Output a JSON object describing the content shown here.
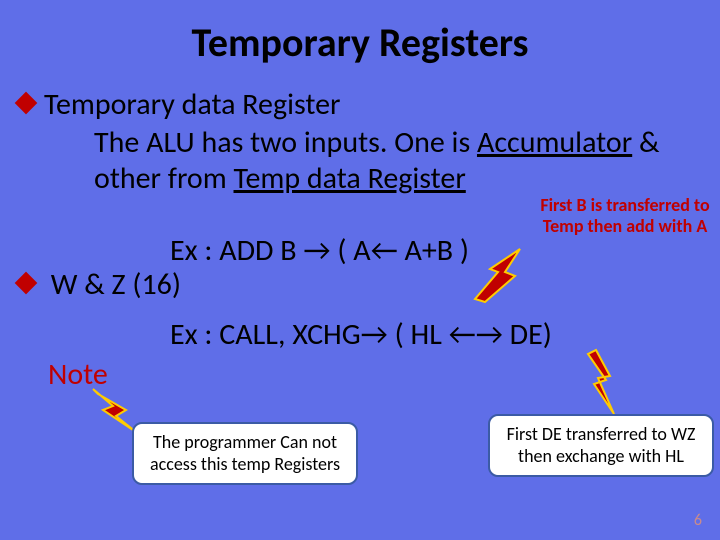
{
  "title": "Temporary Registers",
  "bullets": {
    "b1": "Temporary data Register",
    "b1_line1a": "The ALU has two inputs. One is ",
    "b1_line1b": "Accumulator",
    "b1_line1c": " &",
    "b1_line2a": "other from ",
    "b1_line2b": "Temp data Register",
    "b1_ex": "Ex : ADD B → ( A← A+B )",
    "b2": "W & Z (16)",
    "b2_ex": "Ex : CALL, XCHG→ ( HL ←→ DE)"
  },
  "callout1": "First B is transferred to Temp then add with A",
  "note_label": "Note",
  "box_left": "The programmer Can not access this temp Registers",
  "box_right": "First  DE transferred to WZ then  exchange with  HL",
  "page_number": "6"
}
